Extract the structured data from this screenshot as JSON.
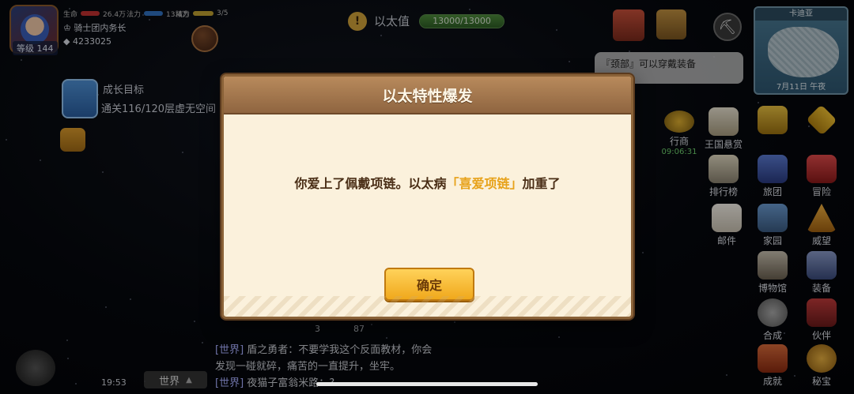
{
  "player": {
    "level": "等级 144",
    "hp_label": "生命",
    "hp_value": "26.4万",
    "mp_label": "法力",
    "mp_value": "13.4万",
    "sp_label": "精力",
    "sp_value": "3/5",
    "title": "骑士团内务长",
    "gold": "4233025"
  },
  "goal": {
    "title": "成长目标",
    "desc": "通关116/120层虚无空间"
  },
  "ether": {
    "label": "以太值",
    "value": "13000/13000",
    "fill_fraction": 1.0
  },
  "minimap": {
    "title": "卡迪亚",
    "date": "7月11日 午夜"
  },
  "hint": {
    "text": "『颈部』可以穿戴装备"
  },
  "right_menu": {
    "quest_timer": "09:06:31",
    "quest_label": "行商",
    "bounty": "王国悬赏",
    "rank": "排行榜",
    "guild": "旅团",
    "adventure": "冒险",
    "mail": "邮件",
    "home": "家园",
    "prestige": "威望",
    "museum": "博物馆",
    "equip": "装备",
    "craft": "合成",
    "partner": "伙伴",
    "achievement": "成就",
    "treasure": "秘宝"
  },
  "dialog": {
    "title": "以太特性爆发",
    "msg_before": "你爱上了佩戴项链。以太病",
    "msg_highlight": "「喜爱项链」",
    "msg_after": "加重了",
    "confirm": "确定"
  },
  "chat": {
    "line1_channel": "[世界]",
    "line1_text": " 盾之勇者：不要学我这个反面教材，你会",
    "line2_text": "发现一碰就碎，痛苦的一直提升，坐牢。",
    "line3_channel": "[世界]",
    "line3_text": " 夜猫子富翁米路：?",
    "num_a": "3",
    "num_b": "87",
    "clock": "19:53",
    "world_tab": "世界",
    "world_arrow": "▲"
  },
  "colors": {
    "dialog_bg": "#fbf1dc",
    "dialog_header": "#a47a50",
    "highlight": "#e7a21a",
    "confirm": "#f5b830"
  }
}
